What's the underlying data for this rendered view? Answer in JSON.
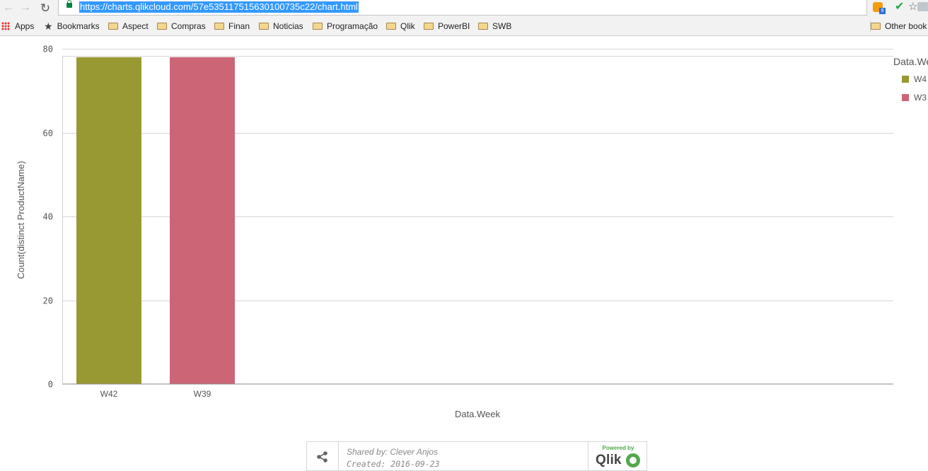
{
  "browser": {
    "url": "https://charts.qlikcloud.com/57e535117515630100735c22/chart.html",
    "ext_badge": "9"
  },
  "bookmarks": [
    {
      "label": "Apps",
      "icon": "apps-grid-icon"
    },
    {
      "label": "Bookmarks",
      "icon": "star-icon"
    },
    {
      "label": "Aspect",
      "icon": "folder-icon"
    },
    {
      "label": "Compras",
      "icon": "folder-icon"
    },
    {
      "label": "Finan",
      "icon": "folder-icon"
    },
    {
      "label": "Noticias",
      "icon": "folder-icon"
    },
    {
      "label": "Programação",
      "icon": "folder-icon"
    },
    {
      "label": "Qlik",
      "icon": "folder-icon"
    },
    {
      "label": "PowerBI",
      "icon": "folder-icon"
    },
    {
      "label": "SWB",
      "icon": "folder-icon"
    },
    {
      "label": "Other book",
      "icon": "folder-icon"
    }
  ],
  "chart_data": {
    "type": "bar",
    "categories": [
      "W42",
      "W39"
    ],
    "values": [
      78,
      78
    ],
    "colors": [
      "#999933",
      "#cc6677"
    ],
    "xlabel": "Data.Week",
    "ylabel": "Count(distinct ProductName)",
    "ylim": [
      0,
      80
    ],
    "yticks": [
      0,
      20,
      40,
      60,
      80
    ],
    "ytick_labels": [
      "0",
      "20",
      "40",
      "60",
      "80"
    ],
    "grid": true,
    "legend": {
      "title": "Data.We",
      "placement": "right",
      "items": [
        {
          "label": "W4",
          "color": "#999933"
        },
        {
          "label": "W3",
          "color": "#cc6677"
        }
      ]
    }
  },
  "footer": {
    "shared_by": "Shared by: Clever Anjos",
    "created": "Created: 2016-09-23",
    "powered_by": "Powered by",
    "brand": "Qlik"
  }
}
